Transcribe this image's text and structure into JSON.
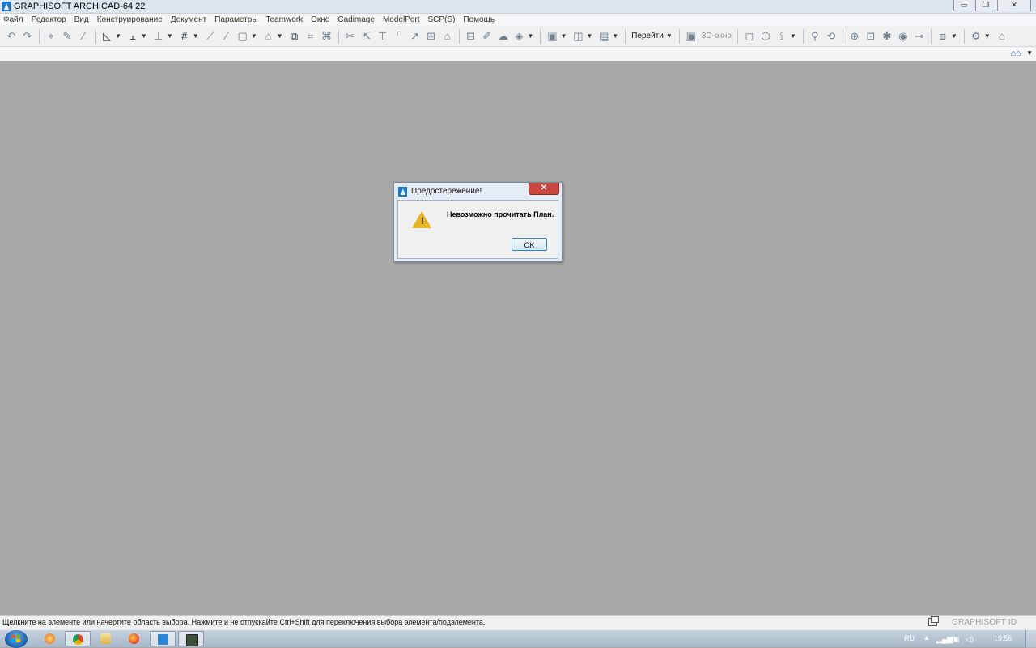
{
  "window": {
    "title": "GRAPHISOFT ARCHICAD-64 22",
    "buttons": [
      "minimize",
      "restore",
      "close"
    ]
  },
  "menu": {
    "items": [
      "Файл",
      "Редактор",
      "Вид",
      "Конструирование",
      "Документ",
      "Параметры",
      "Teamwork",
      "Окно",
      "Cadimage",
      "ModelPort",
      "SCP(S)",
      "Помощь"
    ]
  },
  "toolbar": {
    "goto_label": "Перейти",
    "view3d_label": "3D-окно"
  },
  "dialog": {
    "title": "Предостережение!",
    "message": "Невозможно прочитать План.",
    "ok_label": "OK",
    "icon": "warning-icon"
  },
  "statusbar": {
    "hint": "Щелкните на элементе или начертите область выбора. Нажмите и не отпускайте Ctrl+Shift для переключения выбора элемента/подэлемента.",
    "id_label": "GRAPHISOFT ID"
  },
  "taskbar": {
    "apps": [
      "start-menu",
      "media-player",
      "chrome",
      "file-explorer",
      "firefox",
      "archicad",
      "remote-desktop"
    ],
    "active_app": "archicad",
    "language": "RU",
    "clock": "19:56"
  },
  "colors": {
    "workspace": "#a9a9a9",
    "dialog_frame": "#e4ecf6",
    "close_button": "#c9463d",
    "warning": "#e8b320"
  }
}
